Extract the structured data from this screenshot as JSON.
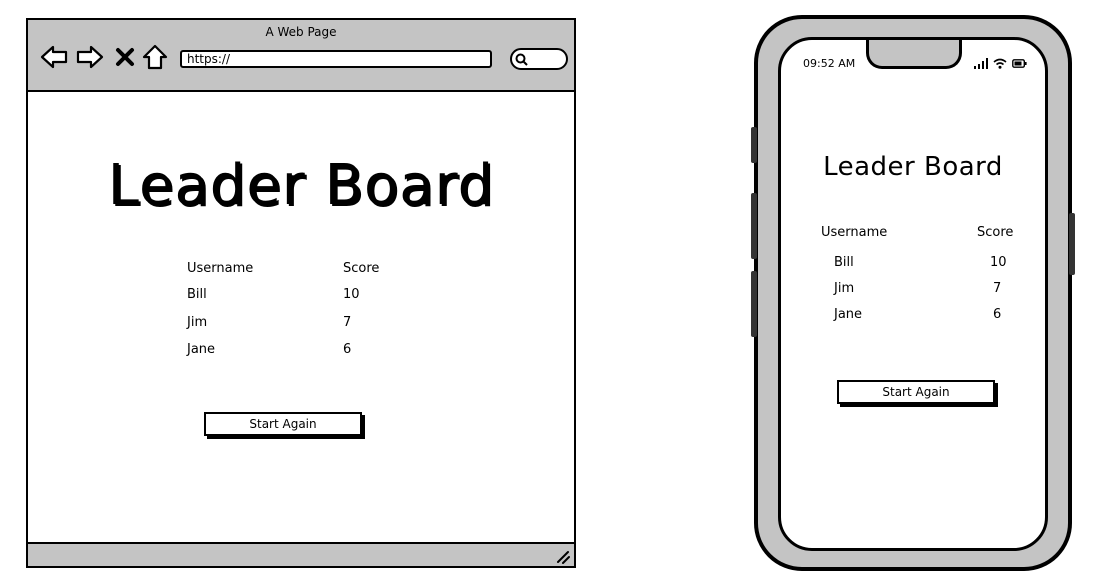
{
  "browser": {
    "title": "A Web Page",
    "url": "https://",
    "page": {
      "heading": "Leader Board",
      "table": {
        "headers": [
          "Username",
          "Score"
        ],
        "rows": [
          {
            "username": "Bill",
            "score": "10"
          },
          {
            "username": "Jim",
            "score": "7"
          },
          {
            "username": "Jane",
            "score": "6"
          }
        ]
      },
      "button_label": "Start Again"
    }
  },
  "phone": {
    "status": {
      "time": "09:52 AM"
    },
    "heading": "Leader Board",
    "table": {
      "headers": [
        "Username",
        "Score"
      ],
      "rows": [
        {
          "username": "Bill",
          "score": "10"
        },
        {
          "username": "Jim",
          "score": "7"
        },
        {
          "username": "Jane",
          "score": "6"
        }
      ]
    },
    "button_label": "Start Again"
  },
  "icons": {
    "back": "back-arrow-icon",
    "forward": "forward-arrow-icon",
    "close": "close-icon",
    "home": "home-icon",
    "search": "search-icon",
    "signal": "signal-icon",
    "wifi": "wifi-icon",
    "battery": "battery-icon"
  },
  "colors": {
    "chrome": "#c4c4c4",
    "ink": "#000000",
    "background": "#ffffff"
  }
}
